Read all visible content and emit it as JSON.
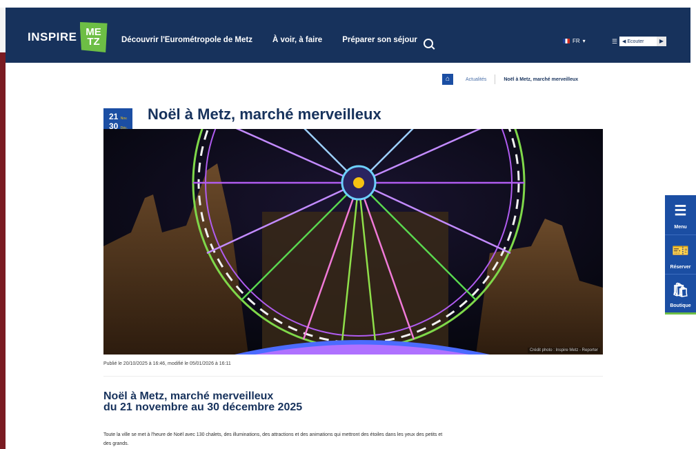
{
  "brand": {
    "logo_left": "INSPIRE",
    "logo_box_top": "ME",
    "logo_box_bottom": "TZ"
  },
  "nav": {
    "items": [
      "Découvrir l'Eurométropole de Metz",
      "À voir, à faire",
      "Préparer son séjour"
    ],
    "lang": "FR",
    "listen_label": "Ecouter"
  },
  "breadcrumb": {
    "items": [
      "Actualités",
      "Noël à Metz, marché merveilleux"
    ]
  },
  "article": {
    "date_start_day": "21",
    "date_start_month": "Nov.",
    "date_end_day": "30",
    "date_end_month": "Déc.",
    "title": "Noël à Metz, marché merveilleux",
    "photo_credit": "Crédit photo : Inspire Metz - Reporter",
    "published": "Publié le 20/10/2025 à 16:46, modifié le 05/01/2026 à 16:11",
    "subtitle_line1": "Noël à Metz, marché merveilleux",
    "subtitle_line2": "du 21 novembre au 30 décembre 2025",
    "intro": "Toute la ville se met à l'heure de Noël avec 130 chalets, des illuminations, des attractions et des animations qui mettront des étoiles dans les yeux des petits et des grands."
  },
  "sidebar": {
    "menu": "Menu",
    "book": "Réserver",
    "shop": "Boutique"
  },
  "colors": {
    "navy": "#17325c",
    "blue": "#1b4ea3",
    "green": "#6dbe45",
    "maroon": "#7a1b22"
  },
  "icons": [
    "search-icon",
    "home-icon",
    "hamburger-icon",
    "ticket-icon",
    "shopping-bag-icon"
  ]
}
